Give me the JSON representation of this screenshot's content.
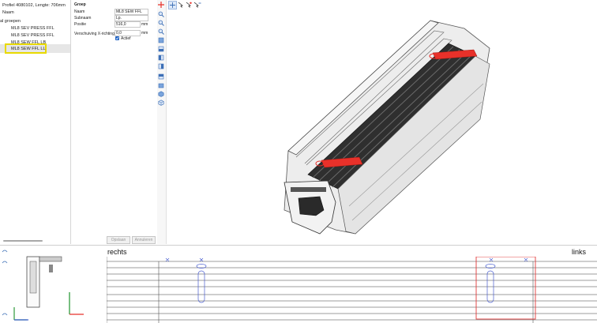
{
  "tree": {
    "header": "Profiel 4080102, Lengte: 706mm",
    "column_header": "Naam",
    "group_label": "al groepen",
    "items": [
      {
        "label": "ML8 SEV PRESS FFL"
      },
      {
        "label": "ML8 SEV PRESS FFL"
      },
      {
        "label": "ML8 SEW FFL LB"
      },
      {
        "label": "ML8 SEW FFL LL"
      }
    ]
  },
  "properties": {
    "section_title": "Groep",
    "fields": [
      {
        "label": "Naam",
        "value": "ML8 SEW FFL",
        "unit": ""
      },
      {
        "label": "Subnaam",
        "value": "Lp.",
        "unit": ""
      },
      {
        "label": "Positie",
        "value": "516,0",
        "unit": "mm"
      },
      {
        "label": "Verschuiving X-richting",
        "value": "0,0",
        "unit": "mm"
      }
    ],
    "active_label": "Actief",
    "active_checked": true,
    "apply_button": "Opslaan",
    "cancel_button": "Annuleren"
  },
  "toolbar": {
    "vertical_icons": [
      "crosshair-icon",
      "zoom-in-icon",
      "zoom-out-icon",
      "zoom-fit-icon",
      "view-top-icon",
      "view-front-icon",
      "view-left-icon",
      "view-right-icon",
      "view-back-icon",
      "view-bottom-icon",
      "view-iso-icon",
      "view-cube-icon"
    ],
    "horizontal_icons": [
      "select-icon",
      "move-icon",
      "rotate-icon",
      "axis-icon"
    ],
    "accent_color": "#e8312a",
    "icon_color": "#3d6fb6"
  },
  "bottom": {
    "left_label": "rechts",
    "right_label": "links"
  },
  "colors": {
    "highlight": "#e8d900",
    "selection_box": "#e23b3b",
    "slot_outline": "#4a5fd0",
    "check_blue": "#1f63c4"
  }
}
